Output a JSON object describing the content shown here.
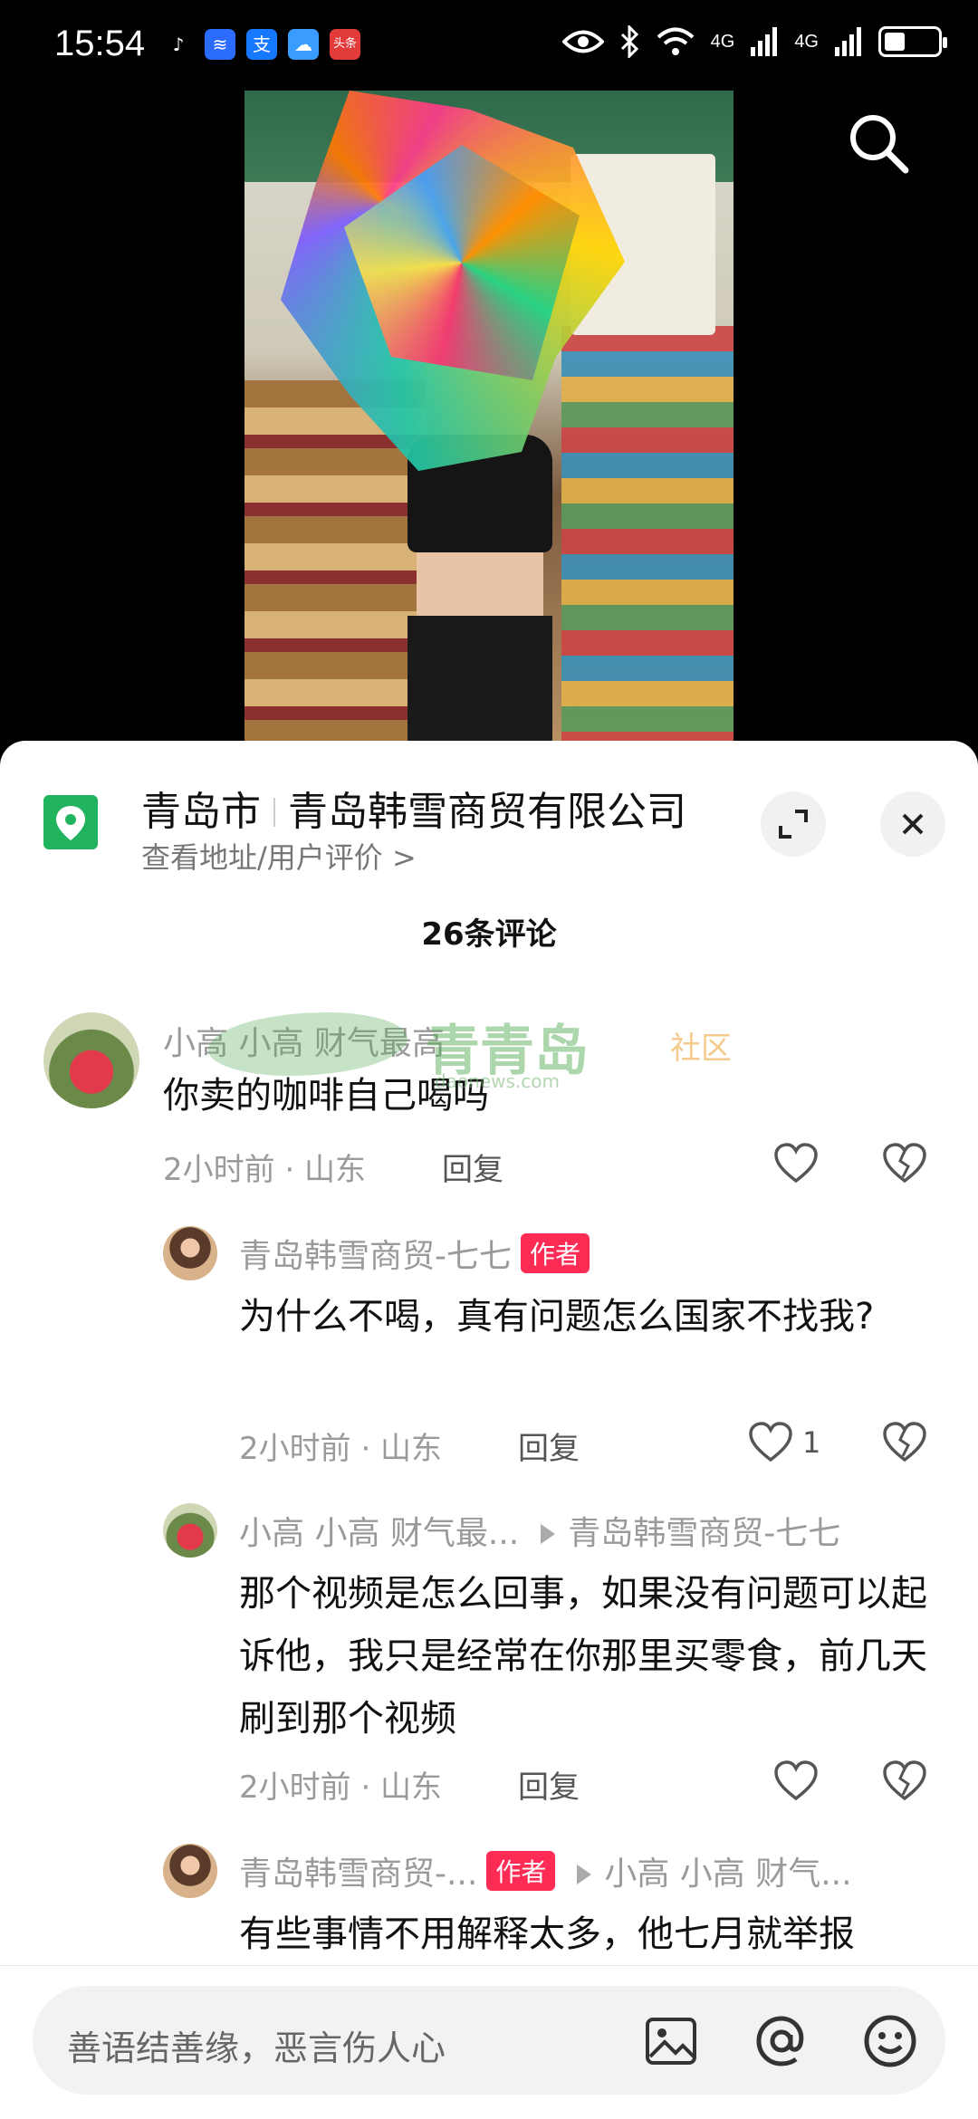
{
  "status_bar": {
    "time": "15:54",
    "apps": [
      {
        "icon": "tiktok-icon",
        "glyph": "♪",
        "color": "#000000"
      },
      {
        "icon": "voice-app-icon",
        "glyph": "≋",
        "color": "#2b6cff"
      },
      {
        "icon": "alipay-icon",
        "glyph": "支",
        "color": "#1677ff"
      },
      {
        "icon": "weather-icon",
        "glyph": "☁",
        "color": "#3a9cff"
      },
      {
        "icon": "toutiao-icon",
        "glyph": "头条",
        "color": "#e33a3a"
      }
    ],
    "signal_left": "4G",
    "signal_right": "4G"
  },
  "location": {
    "city": "青岛市",
    "name": "青岛韩雪商贸有限公司",
    "subtitle": "查看地址/用户评价 >"
  },
  "comments_header": "26条评论",
  "watermark": {
    "text": "青青岛",
    "sub": "社区",
    "url": "daonews.com"
  },
  "comments": [
    {
      "name": "小高 小高 财气最高",
      "text": "你卖的咖啡自己喝吗",
      "meta": "2小时前 · 山东",
      "reply": "回复"
    },
    {
      "name": "青岛韩雪商贸-七七",
      "author_tag": "作者",
      "text": "为什么不喝，真有问题怎么国家不找我?",
      "meta": "2小时前 · 山东",
      "reply": "回复",
      "likes": "1"
    },
    {
      "name": "小高 小高 财气最...",
      "reply_to": "青岛韩雪商贸-七七",
      "text": "那个视频是怎么回事，如果没有问题可以起诉他，我只是经常在你那里买零食，前几天刷到那个视频",
      "meta": "2小时前 · 山东",
      "reply": "回复"
    },
    {
      "name": "青岛韩雪商贸-...",
      "author_tag": "作者",
      "reply_to": "小高 小高 财气...",
      "text": "有些事情不用解释太多，他七月就举报"
    }
  ],
  "input": {
    "placeholder": "善语结善缘，恶言伤人心"
  },
  "colors": {
    "accent": "#fe2c55",
    "location_pin": "#22b35e"
  }
}
